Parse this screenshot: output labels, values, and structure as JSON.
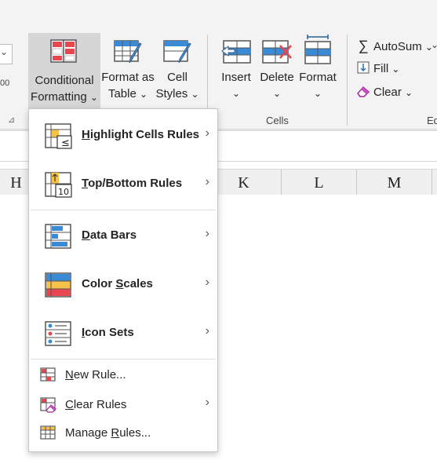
{
  "ribbon": {
    "conditional_formatting": {
      "line1": "Conditional",
      "line2": "Formatting",
      "caret": "⌄"
    },
    "format_as_table": {
      "line1": "Format as",
      "line2": "Table",
      "caret": "⌄"
    },
    "cell_styles": {
      "line1": "Cell",
      "line2": "Styles",
      "caret": "⌄"
    },
    "insert": {
      "label": "Insert",
      "caret": "⌄"
    },
    "delete": {
      "label": "Delete",
      "caret": "⌄"
    },
    "format": {
      "label": "Format",
      "caret": "⌄"
    },
    "cells_group_label": "Cells",
    "editing_group_label": "Ed",
    "autosum": {
      "label": "AutoSum",
      "caret": "⌄"
    },
    "fill": {
      "label": "Fill",
      "caret": "⌄"
    },
    "clear": {
      "label": "Clear",
      "caret": "⌄"
    },
    "left_edge_text": "00"
  },
  "columns": [
    "H",
    "K",
    "L",
    "M"
  ],
  "menu": {
    "big_items": [
      {
        "pre": "",
        "u": "H",
        "post": "ighlight Cells Rules",
        "icon": "highlight-cells-rules-icon",
        "has_submenu": true
      },
      {
        "pre": "",
        "u": "T",
        "post": "op/Bottom Rules",
        "icon": "top-bottom-rules-icon",
        "has_submenu": true
      },
      {
        "pre": "",
        "u": "D",
        "post": "ata Bars",
        "icon": "data-bars-icon",
        "has_submenu": true
      },
      {
        "pre": "Color ",
        "u": "S",
        "post": "cales",
        "icon": "color-scales-icon",
        "has_submenu": true
      },
      {
        "pre": "",
        "u": "I",
        "post": "con Sets",
        "icon": "icon-sets-icon",
        "has_submenu": true
      }
    ],
    "small_items": [
      {
        "pre": "",
        "u": "N",
        "post": "ew Rule...",
        "icon": "new-rule-icon",
        "has_submenu": false
      },
      {
        "pre": "",
        "u": "C",
        "post": "lear Rules",
        "icon": "clear-rules-icon",
        "has_submenu": true
      },
      {
        "pre": "Manage ",
        "u": "R",
        "post": "ules...",
        "icon": "manage-rules-icon",
        "has_submenu": false
      }
    ],
    "chevron": "›"
  },
  "colors": {
    "accent_red": "#e8474f",
    "accent_blue": "#3a8ad6",
    "accent_yellow": "#f7c24a",
    "ribbon_bg": "#f3f3f3"
  }
}
